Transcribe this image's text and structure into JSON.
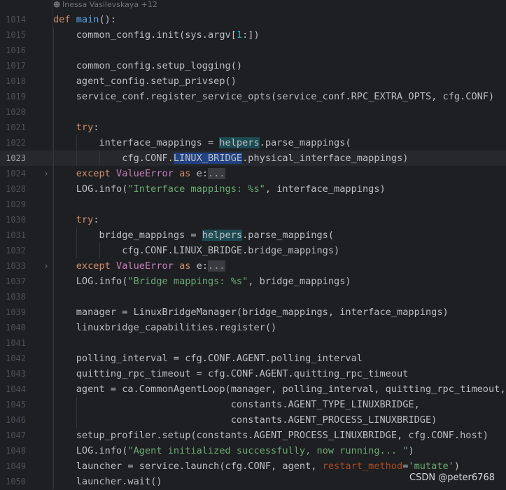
{
  "editor": {
    "author_annotation": "Inessa Vasilevskaya +12",
    "current_line": "1023",
    "lines": [
      {
        "n": "1014",
        "tokens": [
          {
            "t": "def ",
            "c": "kw"
          },
          {
            "t": "main",
            "c": "fn"
          },
          {
            "t": "():",
            "c": ""
          }
        ]
      },
      {
        "n": "1015",
        "tokens": [
          {
            "t": "    common_config.init(sys.argv[",
            "c": ""
          },
          {
            "t": "1",
            "c": "num"
          },
          {
            "t": ":])",
            "c": ""
          }
        ]
      },
      {
        "n": "1016",
        "tokens": []
      },
      {
        "n": "1017",
        "tokens": [
          {
            "t": "    common_config.setup_logging()",
            "c": ""
          }
        ]
      },
      {
        "n": "1018",
        "tokens": [
          {
            "t": "    agent_config.setup_privsep()",
            "c": ""
          }
        ]
      },
      {
        "n": "1019",
        "tokens": [
          {
            "t": "    service_conf.register_service_opts(service_conf.RPC_EXTRA_OPTS, cfg.CONF)",
            "c": ""
          }
        ]
      },
      {
        "n": "1020",
        "tokens": []
      },
      {
        "n": "1021",
        "tokens": [
          {
            "t": "    ",
            "c": ""
          },
          {
            "t": "try",
            "c": "kw"
          },
          {
            "t": ":",
            "c": ""
          }
        ]
      },
      {
        "n": "1022",
        "tokens": [
          {
            "t": "        interface_mappings = ",
            "c": ""
          },
          {
            "t": "helpers",
            "c": "hl"
          },
          {
            "t": ".parse_mappings(",
            "c": ""
          }
        ]
      },
      {
        "n": "1023",
        "tokens": [
          {
            "t": "            cfg.CONF.",
            "c": ""
          },
          {
            "t": "LINUX_BRIDGE",
            "c": "hlb"
          },
          {
            "t": ".physical_interface_mappings)",
            "c": ""
          }
        ]
      },
      {
        "n": "1024",
        "fold": true,
        "tokens": [
          {
            "t": "    ",
            "c": ""
          },
          {
            "t": "except ",
            "c": "kw"
          },
          {
            "t": "ValueError",
            "c": "cls"
          },
          {
            "t": " ",
            "c": ""
          },
          {
            "t": "as",
            "c": "kw"
          },
          {
            "t": " e:",
            "c": ""
          },
          {
            "t": "...",
            "c": "fold-dots"
          }
        ]
      },
      {
        "n": "1028",
        "tokens": [
          {
            "t": "    LOG.info(",
            "c": ""
          },
          {
            "t": "\"Interface mappings: %s\"",
            "c": "str"
          },
          {
            "t": ", interface_mappings)",
            "c": ""
          }
        ]
      },
      {
        "n": "1029",
        "tokens": []
      },
      {
        "n": "1030",
        "tokens": [
          {
            "t": "    ",
            "c": ""
          },
          {
            "t": "try",
            "c": "kw"
          },
          {
            "t": ":",
            "c": ""
          }
        ]
      },
      {
        "n": "1031",
        "tokens": [
          {
            "t": "        bridge_mappings = ",
            "c": ""
          },
          {
            "t": "helpers",
            "c": "hl"
          },
          {
            "t": ".parse_mappings(",
            "c": ""
          }
        ]
      },
      {
        "n": "1032",
        "tokens": [
          {
            "t": "            cfg.CONF.LINUX_BRIDGE.bridge_mappings)",
            "c": ""
          }
        ]
      },
      {
        "n": "1033",
        "fold": true,
        "tokens": [
          {
            "t": "    ",
            "c": ""
          },
          {
            "t": "except ",
            "c": "kw"
          },
          {
            "t": "ValueError",
            "c": "cls"
          },
          {
            "t": " ",
            "c": ""
          },
          {
            "t": "as",
            "c": "kw"
          },
          {
            "t": " e:",
            "c": ""
          },
          {
            "t": "...",
            "c": "fold-dots"
          }
        ]
      },
      {
        "n": "1037",
        "tokens": [
          {
            "t": "    LOG.info(",
            "c": ""
          },
          {
            "t": "\"Bridge mappings: %s\"",
            "c": "str"
          },
          {
            "t": ", bridge_mappings)",
            "c": ""
          }
        ]
      },
      {
        "n": "1038",
        "tokens": []
      },
      {
        "n": "1039",
        "tokens": [
          {
            "t": "    manager = LinuxBridgeManager(bridge_mappings, interface_mappings)",
            "c": ""
          }
        ]
      },
      {
        "n": "1040",
        "tokens": [
          {
            "t": "    linuxbridge_capabilities.register()",
            "c": ""
          }
        ]
      },
      {
        "n": "1041",
        "tokens": []
      },
      {
        "n": "1042",
        "tokens": [
          {
            "t": "    polling_interval = cfg.CONF.AGENT.polling_interval",
            "c": ""
          }
        ]
      },
      {
        "n": "1043",
        "tokens": [
          {
            "t": "    quitting_rpc_timeout = cfg.CONF.AGENT.quitting_rpc_timeout",
            "c": ""
          }
        ]
      },
      {
        "n": "1044",
        "tokens": [
          {
            "t": "    agent = ca.CommonAgentLoop(manager, polling_interval, quitting_rpc_timeout,",
            "c": ""
          }
        ]
      },
      {
        "n": "1045",
        "tokens": [
          {
            "t": "                               constants.AGENT_TYPE_LINUXBRIDGE,",
            "c": ""
          }
        ]
      },
      {
        "n": "1046",
        "tokens": [
          {
            "t": "                               constants.AGENT_PROCESS_LINUXBRIDGE)",
            "c": ""
          }
        ]
      },
      {
        "n": "1047",
        "tokens": [
          {
            "t": "    setup_profiler.setup(constants.AGENT_PROCESS_LINUXBRIDGE, cfg.CONF.host)",
            "c": ""
          }
        ]
      },
      {
        "n": "1048",
        "tokens": [
          {
            "t": "    LOG.info(",
            "c": ""
          },
          {
            "t": "\"Agent initialized successfully, now running... \"",
            "c": "str"
          },
          {
            "t": ")",
            "c": ""
          }
        ]
      },
      {
        "n": "1049",
        "tokens": [
          {
            "t": "    launcher = service.launch(cfg.CONF, agent, ",
            "c": ""
          },
          {
            "t": "restart_method",
            "c": "param"
          },
          {
            "t": "=",
            "c": ""
          },
          {
            "t": "'mutate'",
            "c": "str"
          },
          {
            "t": ")",
            "c": ""
          }
        ]
      },
      {
        "n": "1050",
        "tokens": [
          {
            "t": "    launcher.wait()",
            "c": ""
          }
        ]
      }
    ]
  },
  "watermark": "CSDN @peter6768",
  "icons": {
    "author": "person-icon",
    "fold": "fold-chevron-icon"
  }
}
